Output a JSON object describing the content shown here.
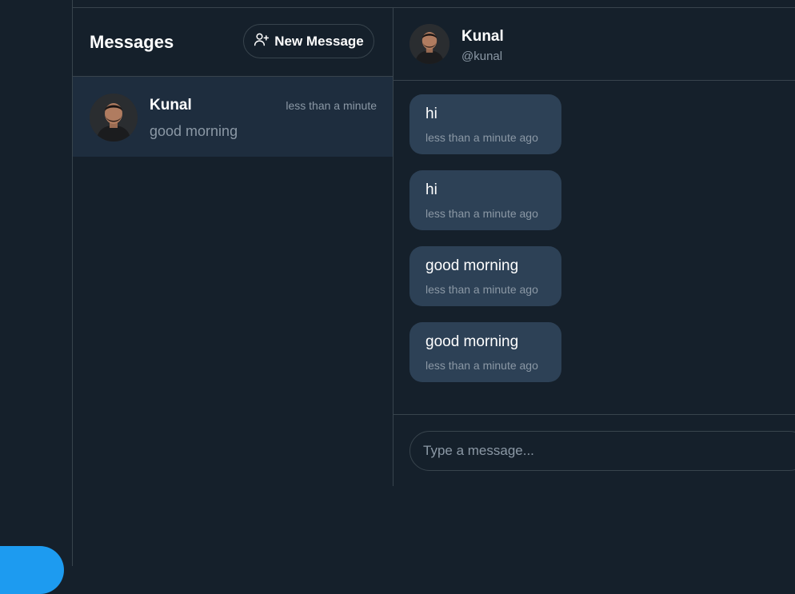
{
  "sidebar": {
    "compose_button_color": "#1d9bf0"
  },
  "conversations": {
    "title": "Messages",
    "new_message_label": "New Message",
    "new_message_icon": "user-plus-icon",
    "items": [
      {
        "name": "Kunal",
        "time": "less than a minute",
        "preview": "good morning"
      }
    ]
  },
  "chat": {
    "name": "Kunal",
    "handle": "@kunal",
    "messages": [
      {
        "text": "hi",
        "time": "less than a minute ago"
      },
      {
        "text": "hi",
        "time": "less than a minute ago"
      },
      {
        "text": "good morning",
        "time": "less than a minute ago"
      },
      {
        "text": "good morning",
        "time": "less than a minute ago"
      }
    ],
    "input_placeholder": "Type a message..."
  },
  "colors": {
    "background": "#15202b",
    "border": "#38444d",
    "selected_row": "#1e2d3e",
    "bubble": "#2d4156",
    "muted_text": "#8b98a5",
    "accent": "#1d9bf0"
  }
}
